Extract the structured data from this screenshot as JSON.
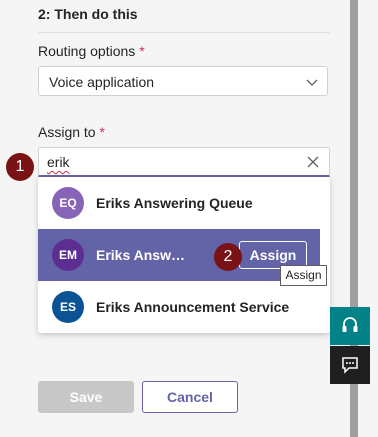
{
  "section": {
    "title": "2: Then do this"
  },
  "routing": {
    "label": "Routing options",
    "required_mark": "*",
    "value": "Voice application"
  },
  "assign_to": {
    "label": "Assign to",
    "required_mark": "*",
    "search_value": "erik"
  },
  "options": [
    {
      "initials": "EQ",
      "name": "Eriks Answering Queue",
      "avatar_color": "#8764b8"
    },
    {
      "initials": "EM",
      "name": "Eriks Answ…",
      "avatar_color": "#5c2e91",
      "action_label": "Assign",
      "highlighted": true
    },
    {
      "initials": "ES",
      "name": "Eriks Announcement Service",
      "avatar_color": "#0b5394"
    }
  ],
  "tooltip": {
    "text": "Assign"
  },
  "steps": {
    "one": "1",
    "two": "2"
  },
  "footer": {
    "save_label": "Save",
    "cancel_label": "Cancel"
  },
  "colors": {
    "accent": "#6264a7",
    "required": "#c4314b",
    "step_marker": "#7a1315",
    "side_teal": "#038387"
  },
  "icons": {
    "routing_dropdown": "chevron-down-icon",
    "search_clear": "close-icon",
    "side_top": "headset-icon",
    "side_bottom": "feedback-icon"
  }
}
